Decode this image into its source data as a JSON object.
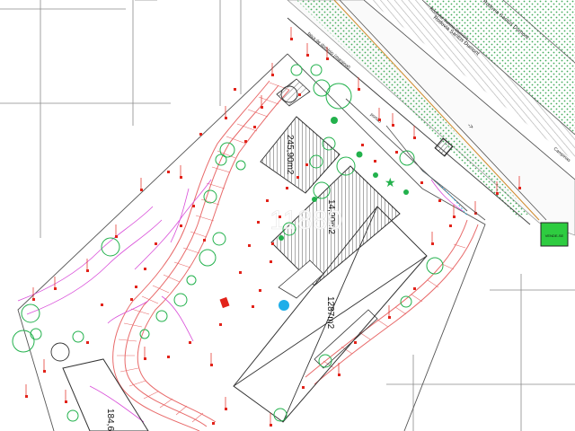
{
  "plan": {
    "road_name_1": "Rodovia Santos Dumont",
    "road_name_2": "Rodovia Santos Dumont",
    "road_name_3": "Rodovia Santos Dumont",
    "road_label_small": "Rodovia Santos Dumont",
    "verge_label": "faixa de domínio (marginal)",
    "direction_arrow": "->",
    "gate_label": "portão",
    "area_1": "245,90m2",
    "area_2": "14,90m2",
    "area_3": "1287m2",
    "area_4": "184,6",
    "watermark": "11880",
    "right_edge_label": "Campinas",
    "sign_text": "VENDE-SE"
  },
  "colors": {
    "road_hatch": "#2fa34a",
    "tree_green": "#22b14c",
    "red_marks": "#e2231a",
    "path_red": "#e86a6a",
    "magenta_lines": "#d94fd9",
    "grey_lines": "#707070",
    "building_hatch": "#555555",
    "cyan_marker": "#1faee9",
    "sign_fill": "#2ecc40"
  }
}
